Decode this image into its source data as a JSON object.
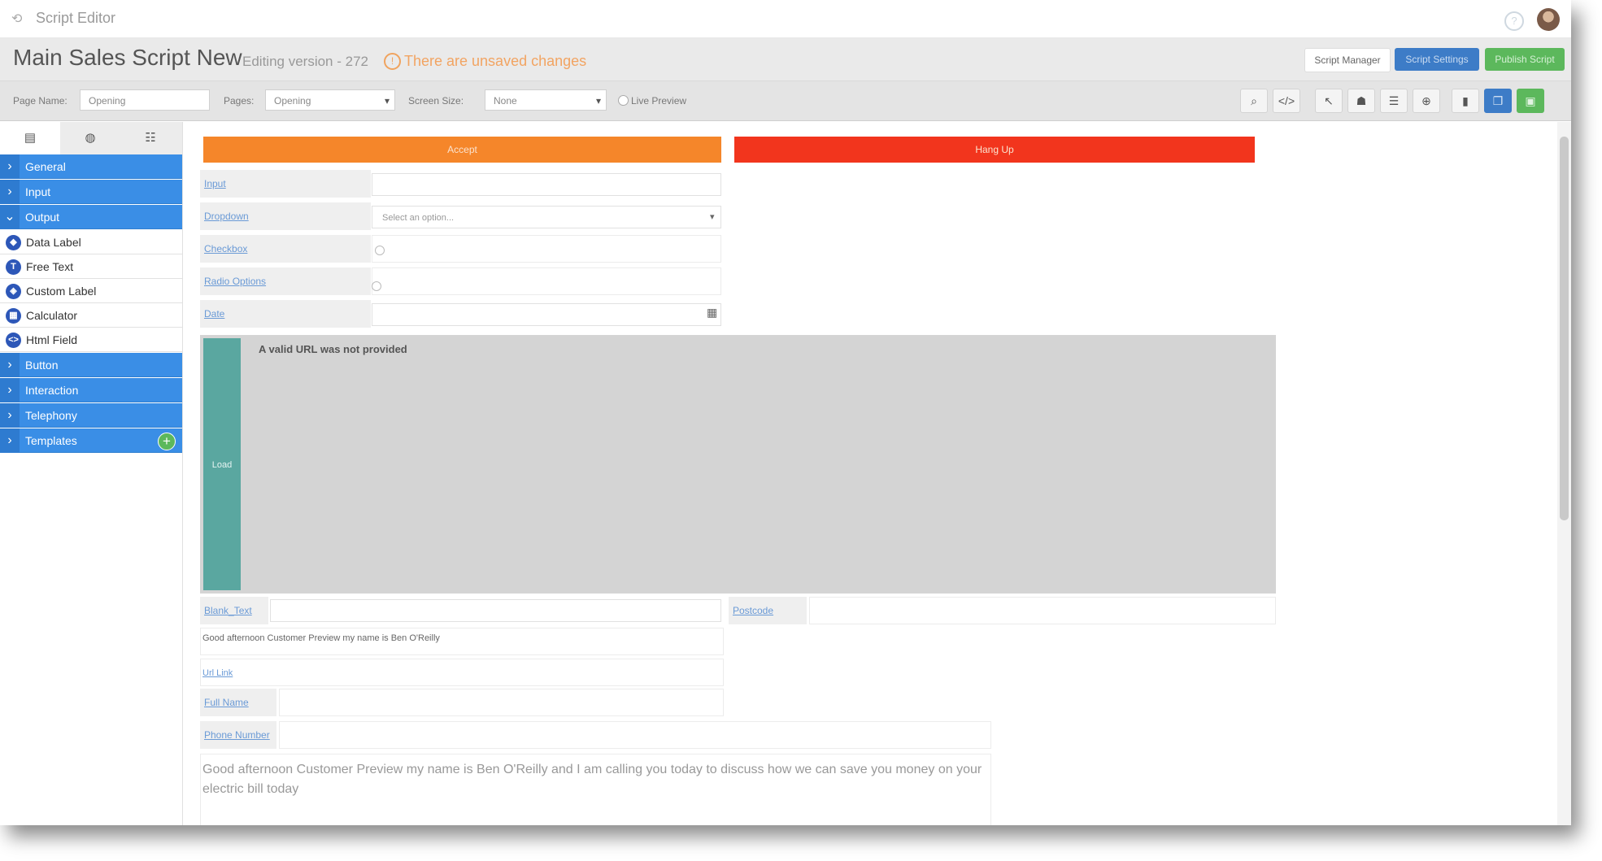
{
  "app": {
    "title": "Script Editor"
  },
  "header": {
    "title": "Main Sales Script New",
    "version": "Editing version - 272",
    "warning": "There are unsaved changes",
    "buttons": {
      "manager": "Script Manager",
      "settings": "Script Settings",
      "publish": "Publish Script"
    }
  },
  "toolbar": {
    "page_name_label": "Page Name:",
    "page_name_value": "Opening",
    "pages_label": "Pages:",
    "pages_value": "Opening",
    "screen_size_label": "Screen Size:",
    "screen_size_value": "None",
    "live_preview_label": "Live Preview",
    "icon_buttons": [
      "magnify-icon",
      "code-icon",
      "cursor-icon",
      "hierarchy-icon",
      "align-icon",
      "target-icon",
      "file-icon",
      "copy-icon",
      "save-icon"
    ]
  },
  "sidebar": {
    "tabs": [
      "components-tab",
      "globe-tab",
      "database-tab"
    ],
    "items": [
      {
        "label": "General",
        "type": "category"
      },
      {
        "label": "Input",
        "type": "category"
      },
      {
        "label": "Output",
        "type": "category",
        "expanded": true
      },
      {
        "label": "Data Label",
        "type": "sub",
        "icon": "tag-icon"
      },
      {
        "label": "Free Text",
        "type": "sub",
        "icon": "text-icon"
      },
      {
        "label": "Custom Label",
        "type": "sub",
        "icon": "tags-icon"
      },
      {
        "label": "Calculator",
        "type": "sub",
        "icon": "calculator-icon"
      },
      {
        "label": "Html Field",
        "type": "sub",
        "icon": "code-icon"
      },
      {
        "label": "Button",
        "type": "category"
      },
      {
        "label": "Interaction",
        "type": "category"
      },
      {
        "label": "Telephony",
        "type": "category"
      },
      {
        "label": "Templates",
        "type": "category"
      }
    ]
  },
  "canvas": {
    "accept_button": "Accept",
    "hangup_button": "Hang Up",
    "accept_color": "#f5862a",
    "hangup_color": "#f2351d",
    "fields": {
      "input": "Input",
      "dropdown": "Dropdown",
      "dropdown_placeholder": "Select an option...",
      "checkbox": "Checkbox",
      "radio": "Radio Options",
      "date": "Date"
    },
    "iframe": {
      "side_label": "Load",
      "message": "A valid URL was not provided"
    },
    "blank_text": "Blank_Text",
    "postcode": "Postcode",
    "greeting": "Good afternoon Customer Preview my name is Ben O'Reilly",
    "url_link": "Url Link",
    "full_name": "Full Name",
    "phone_number": "Phone Number",
    "long_text": "Good afternoon Customer Preview my name is Ben O'Reilly and I am calling you today to discuss how we can save you money on your electric bill today"
  }
}
